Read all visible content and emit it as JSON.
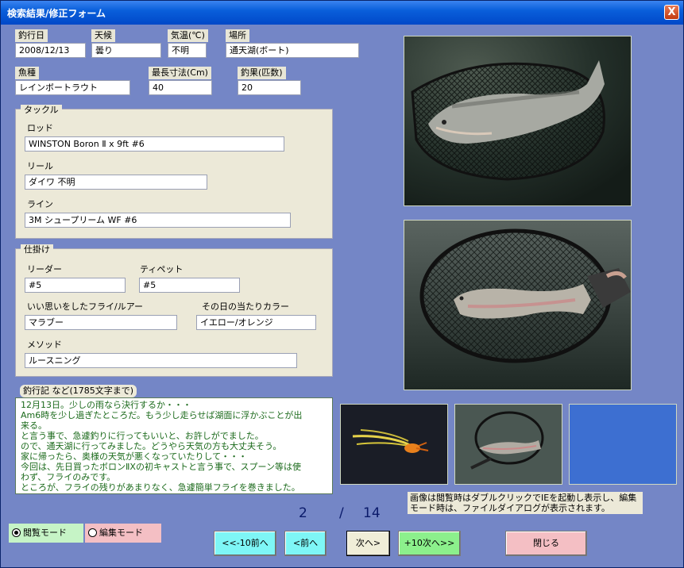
{
  "window": {
    "title": "検索結果/修正フォーム",
    "close_label": "X"
  },
  "fields": {
    "date": {
      "label": "釣行日",
      "value": "2008/12/13"
    },
    "weather": {
      "label": "天候",
      "value": "曇り"
    },
    "temp": {
      "label": "気温(℃)",
      "value": "不明"
    },
    "place": {
      "label": "場所",
      "value": "通天湖(ボート)"
    },
    "fish": {
      "label": "魚種",
      "value": "レインボートラウト"
    },
    "maxsize": {
      "label": "最長寸法(Cm)",
      "value": "40"
    },
    "catch": {
      "label": "釣果(匹数)",
      "value": "20"
    }
  },
  "tackle": {
    "title": "タックル",
    "rod": {
      "label": "ロッド",
      "value": "WINSTON Boron Ⅱ x 9ft #6"
    },
    "reel": {
      "label": "リール",
      "value": "ダイワ 不明"
    },
    "line": {
      "label": "ライン",
      "value": "3M シュープリーム WF #6"
    }
  },
  "rig": {
    "title": "仕掛け",
    "leader": {
      "label": "リーダー",
      "value": "#5"
    },
    "tippet": {
      "label": "ティペット",
      "value": "#5"
    },
    "fly": {
      "label": "いい思いをしたフライ/ルアー",
      "value": "マラブー"
    },
    "color": {
      "label": "その日の当たりカラー",
      "value": "イエロー/オレンジ"
    },
    "method": {
      "label": "メソッド",
      "value": "ルースニング"
    }
  },
  "memo": {
    "label": "釣行記 など(1785文字まで)",
    "lines": [
      "12月13日。少しの雨なら決行するか・・・",
      "Am6時を少し過ぎたところだ。もう少し走らせば湖面に浮かぶことが出",
      "来る。",
      "と言う事で、急遽釣りに行ってもいいと、お許しがでました。",
      "ので、通天湖に行ってみました。どうやら天気の方も大丈夫そう。",
      "家に帰ったら、奥様の天気が悪くなっていたりして・・・",
      "今回は、先日買ったボロンⅡXの初キャストと言う事で、スプーン等は使",
      "わず、フライのみです。",
      "ところが、フライの残りがあまりなく、急遽簡単フライを巻きました。"
    ]
  },
  "note": {
    "line1": "画像は閲覧時はダブルクリックでIEを起動し表示し、編集",
    "line2": "モード時は、ファイルダイアログが表示されます。"
  },
  "pager": {
    "current": "2",
    "separator": "/",
    "total": "14"
  },
  "modes": {
    "view": "閲覧モード",
    "edit": "編集モード",
    "selected": "view"
  },
  "buttons": {
    "prev10": "<<-10前へ",
    "prev": "<前へ",
    "next": "次へ>",
    "next10": "+10次へ>>",
    "close": "閉じる"
  },
  "colors": {
    "background": "#7486c6",
    "titlebar": "#0a5fdb",
    "btn_cyan": "#7ef6f6",
    "btn_next": "#f0eed8",
    "btn_green": "#8cf08c",
    "btn_pink": "#f4bfc4",
    "memo_text": "#1b6a1b",
    "thumb3": "#3d6fd1"
  },
  "photos": {
    "main1": "trout-in-landing-net",
    "main2": "rainbow-trout-in-net",
    "thumb1": "orange-yellow-fly",
    "thumb2": "trout-in-net-thumbnail",
    "thumb3": "empty-blue-slot"
  }
}
